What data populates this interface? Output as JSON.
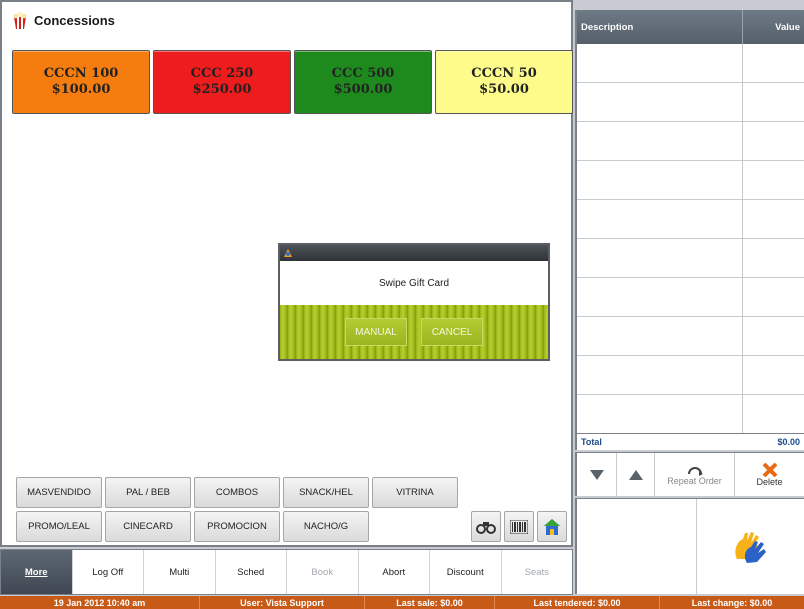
{
  "header": {
    "title": "Concessions",
    "icon": "popcorn-icon"
  },
  "items": [
    {
      "name": "CCCN 100",
      "price": "$100.00",
      "color": "#f57c0e"
    },
    {
      "name": "CCC 250",
      "price": "$250.00",
      "color": "#ee1c1c"
    },
    {
      "name": "CCC 500",
      "price": "$500.00",
      "color": "#1e8a1e"
    },
    {
      "name": "CCCN 50",
      "price": "$50.00",
      "color": "#fdfc8a"
    }
  ],
  "modal": {
    "message": "Swipe Gift Card",
    "manual_label": "MANUAL",
    "cancel_label": "CANCEL"
  },
  "categories": {
    "row1": [
      "MASVENDIDO",
      "PAL / BEB",
      "COMBOS",
      "SNACK/HEL",
      "VITRINA"
    ],
    "row2": [
      "PROMO/LEAL",
      "CINECARD",
      "PROMOCION",
      "NACHO/G"
    ]
  },
  "tools": [
    "binoculars-icon",
    "barcode-icon",
    "home-icon"
  ],
  "order": {
    "col_description": "Description",
    "col_value": "Value",
    "total_label": "Total",
    "total_value": "$0.00"
  },
  "controls": {
    "down": "down-arrow-icon",
    "up": "up-arrow-icon",
    "repeat_label": "Repeat Order",
    "delete_label": "Delete"
  },
  "nav": {
    "more": "More",
    "log_off": "Log Off",
    "multi": "Multi",
    "sched": "Sched",
    "book": "Book",
    "abort": "Abort",
    "discount": "Discount",
    "seats": "Seats"
  },
  "status": {
    "datetime": "19 Jan 2012 10:40 am",
    "user": "User: Vista Support",
    "last_sale": "Last sale: $0.00",
    "last_tendered": "Last tendered: $0.00",
    "last_change": "Last change: $0.00"
  },
  "colors": {
    "status_bar": "#c85a18",
    "modal_green": "#9ab51c",
    "total_text": "#1d4d8c"
  }
}
